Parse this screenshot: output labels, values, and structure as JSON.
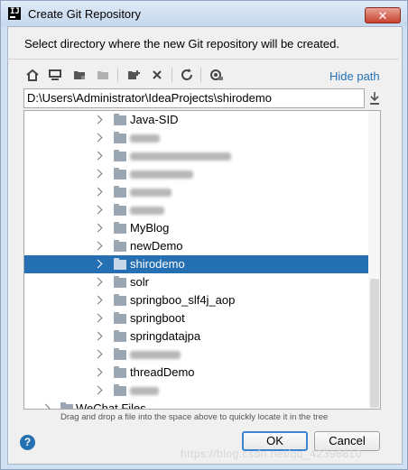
{
  "window": {
    "title": "Create Git Repository",
    "close_label": "✕"
  },
  "instruction": "Select directory where the new Git repository will be created.",
  "toolbar": {
    "hide_path_label": "Hide path"
  },
  "path_field": {
    "value": "D:\\Users\\Administrator\\IdeaProjects\\shirodemo"
  },
  "tree": {
    "items": [
      {
        "label": "Java-SID",
        "blurred": false
      },
      {
        "label": "",
        "blurred": true
      },
      {
        "label": "",
        "blurred": true
      },
      {
        "label": "",
        "blurred": true
      },
      {
        "label": "",
        "blurred": true
      },
      {
        "label": "",
        "blurred": true
      },
      {
        "label": "MyBlog",
        "blurred": false
      },
      {
        "label": "newDemo",
        "blurred": false
      },
      {
        "label": "shirodemo",
        "blurred": false,
        "selected": true
      },
      {
        "label": "solr",
        "blurred": false
      },
      {
        "label": "springboo_slf4j_aop",
        "blurred": false
      },
      {
        "label": "springboot",
        "blurred": false
      },
      {
        "label": "springdatajpa",
        "blurred": false
      },
      {
        "label": "",
        "blurred": true
      },
      {
        "label": "threadDemo",
        "blurred": false
      },
      {
        "label": "",
        "blurred": true
      },
      {
        "label": "WeChat Files",
        "blurred": false
      }
    ]
  },
  "hint": "Drag and drop a file into the space above to quickly locate it in the tree",
  "buttons": {
    "help": "?",
    "ok": "OK",
    "cancel": "Cancel"
  },
  "watermark": "https://blog.csdn.net/qq_42396810",
  "colors": {
    "selection": "#2470b3",
    "link": "#2470b3"
  }
}
